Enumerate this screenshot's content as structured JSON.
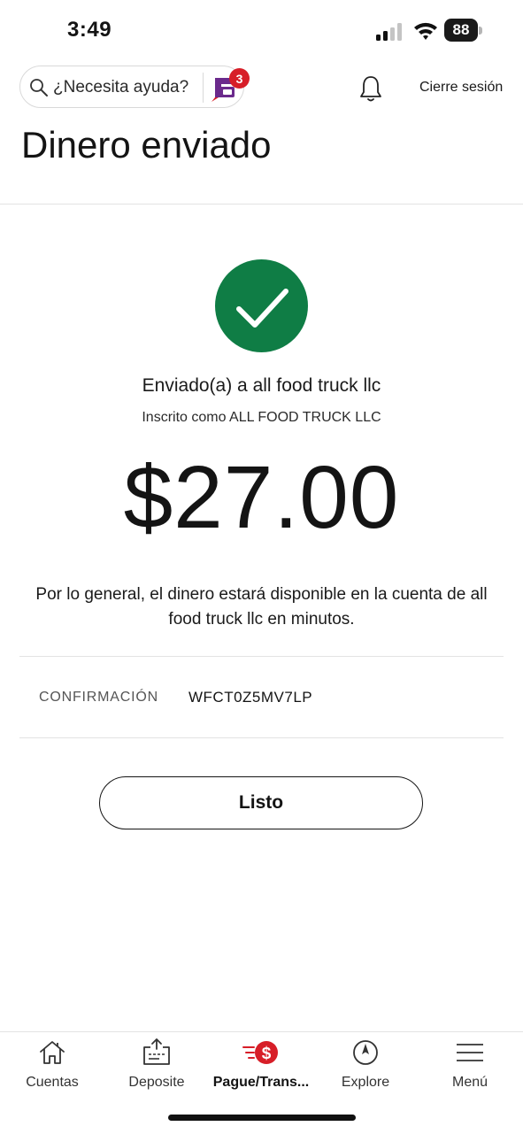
{
  "status_bar": {
    "time": "3:49",
    "battery": "88"
  },
  "header": {
    "search_placeholder": "¿Necesita ayuda?",
    "assistant_badge": "3",
    "logout": "Cierre sesión",
    "title": "Dinero enviado"
  },
  "confirmation": {
    "sent_to": "Enviado(a) a all food truck llc",
    "enrolled_as": "Inscrito como ALL FOOD TRUCK LLC",
    "amount": "$27.00",
    "availability_note": "Por lo general, el dinero estará disponible en la cuenta de all food truck llc en minutos.",
    "confirmation_label": "CONFIRMACIÓN",
    "confirmation_code": "WFCT0Z5MV7LP",
    "done_label": "Listo"
  },
  "nav": {
    "items": [
      {
        "label": "Cuentas",
        "icon": "home-icon"
      },
      {
        "label": "Deposite",
        "icon": "deposit-icon"
      },
      {
        "label": "Pague/Trans...",
        "icon": "pay-transfer-icon",
        "active": true
      },
      {
        "label": "Explore",
        "icon": "compass-icon"
      },
      {
        "label": "Menú",
        "icon": "menu-icon"
      }
    ]
  },
  "colors": {
    "success": "#0f7d45",
    "accent": "#d71e28",
    "assistant": "#6b2a8c"
  }
}
